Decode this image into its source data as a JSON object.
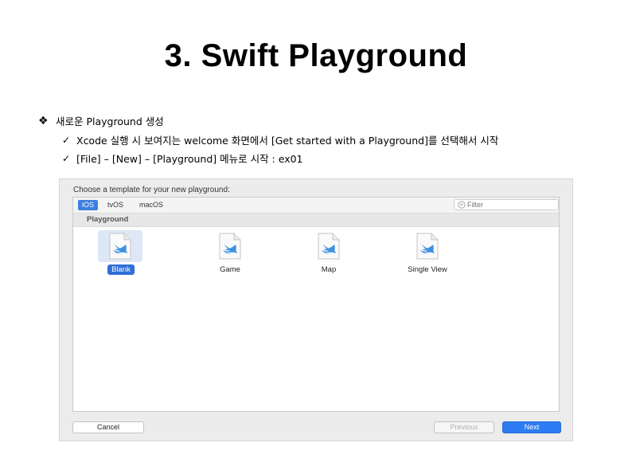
{
  "slide": {
    "title": "3. Swift Playground",
    "bullet": "새로운 Playground 생성",
    "subitems": [
      "Xcode 실행 시 보여지는 welcome 화면에서 [Get started with a Playground]를 선택해서 시작",
      "[File] – [New] – [Playground] 메뉴로 시작 : ex01"
    ]
  },
  "dialog": {
    "heading": "Choose a template for your new playground:",
    "tabs": [
      "iOS",
      "tvOS",
      "macOS"
    ],
    "selected_tab": "iOS",
    "filter_placeholder": "Filter",
    "section": "Playground",
    "templates": [
      "Blank",
      "Game",
      "Map",
      "Single View"
    ],
    "selected_template": "Blank",
    "buttons": {
      "cancel": "Cancel",
      "previous": "Previous",
      "next": "Next"
    }
  },
  "colors": {
    "accent": "#2d7cf3",
    "swift": "#3d8fe0",
    "selection": "#dde7f5"
  }
}
